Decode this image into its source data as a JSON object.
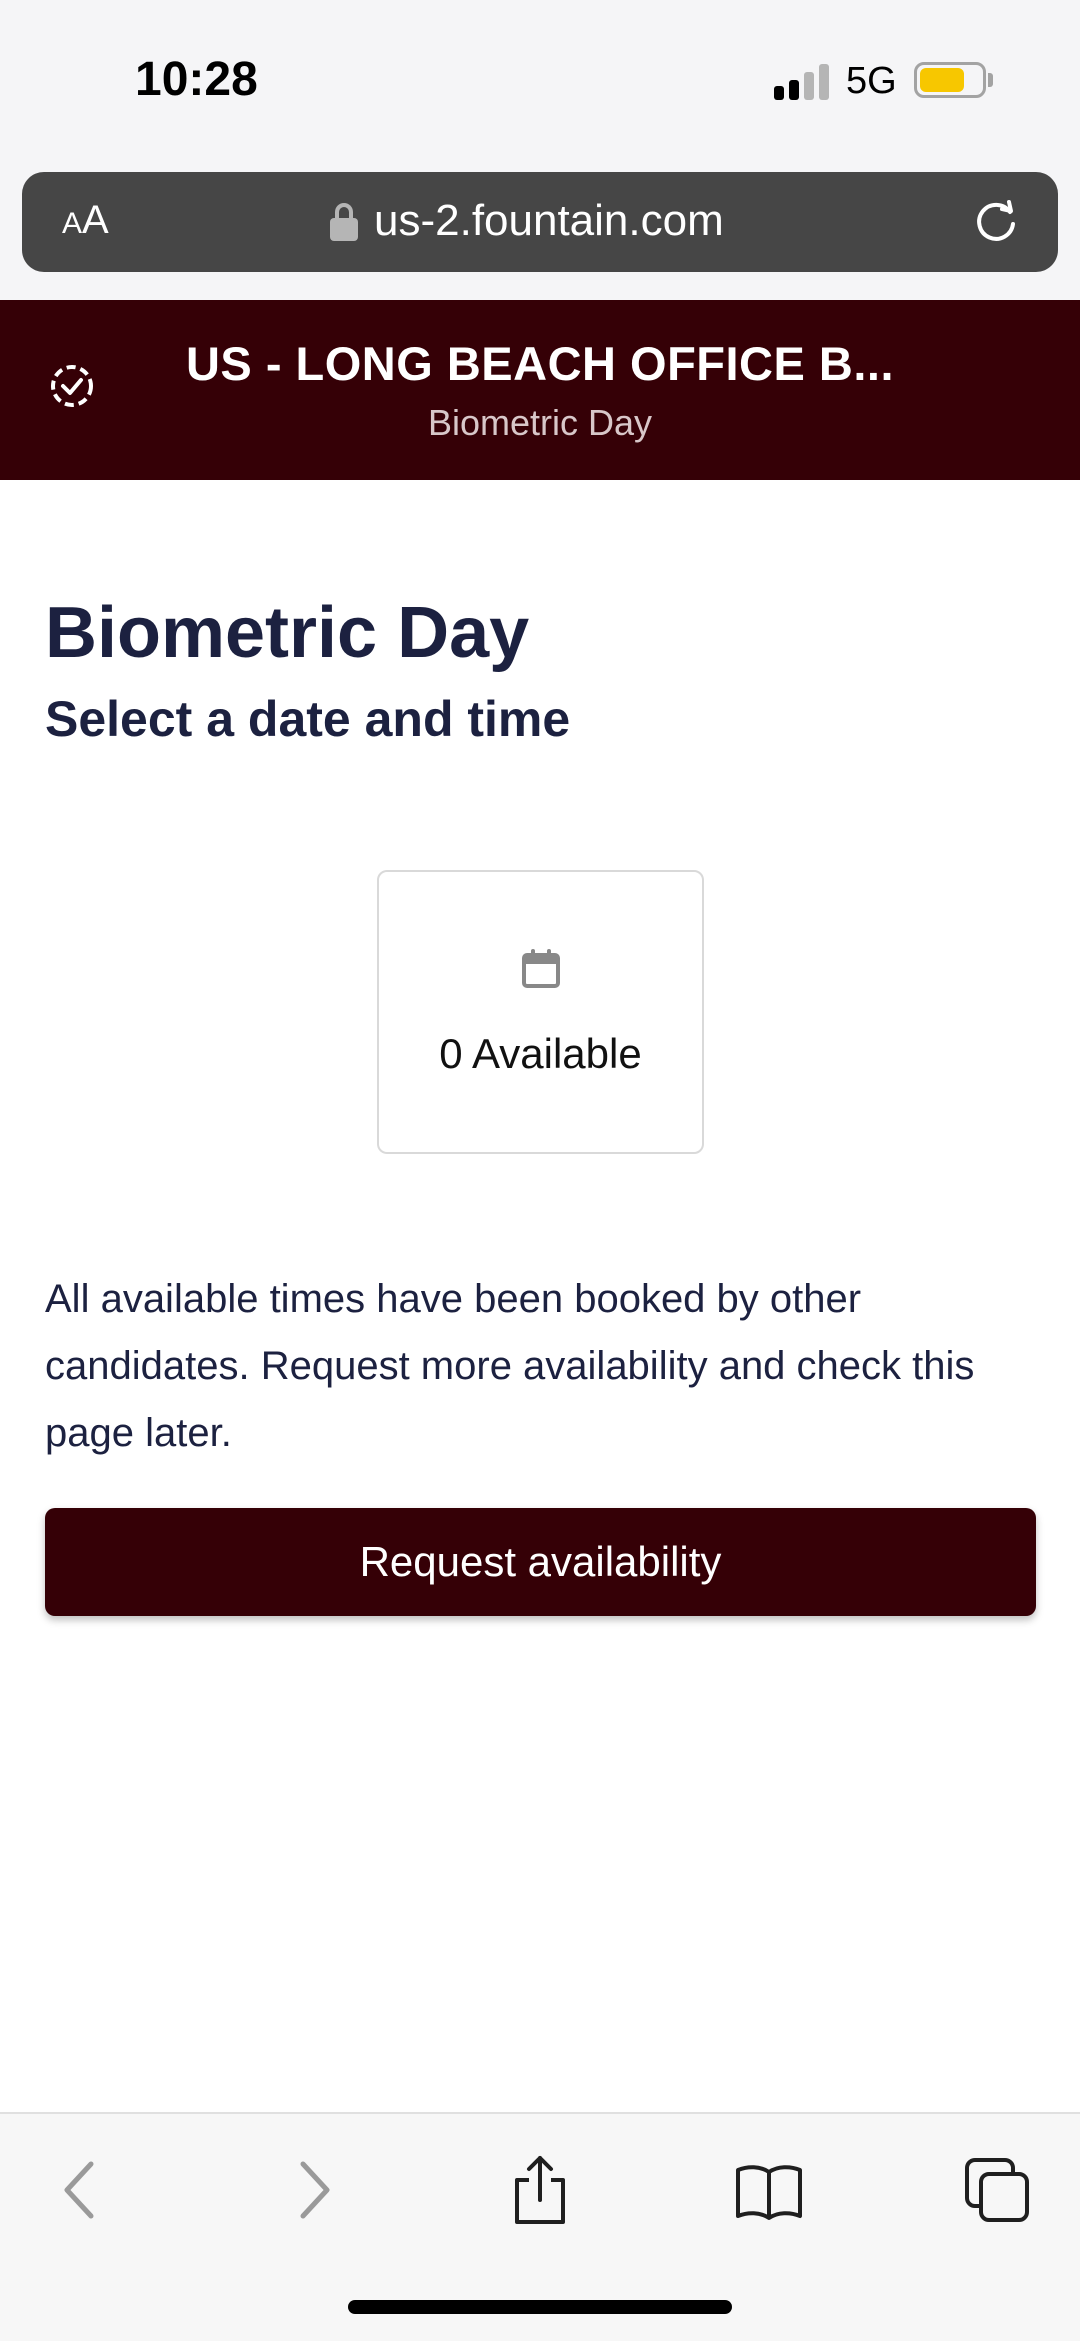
{
  "status_bar": {
    "time": "10:28",
    "network": "5G",
    "battery_color": "#f7c700"
  },
  "browser": {
    "text_size_label": "AA",
    "url": "us-2.fountain.com"
  },
  "header": {
    "title": "US - LONG BEACH OFFICE B...",
    "subtitle": "Biometric Day",
    "background_color": "#350006"
  },
  "main": {
    "title": "Biometric Day",
    "subtitle": "Select a date and time",
    "availability_card": {
      "icon": "calendar-icon",
      "label": "0 Available"
    },
    "info_text": "All available times have been booked by other candidates. Request more availability and check this page later.",
    "request_button_label": "Request availability"
  },
  "toolbar": {
    "icons": [
      "back-icon",
      "forward-icon",
      "share-icon",
      "bookmarks-icon",
      "tabs-icon"
    ]
  }
}
